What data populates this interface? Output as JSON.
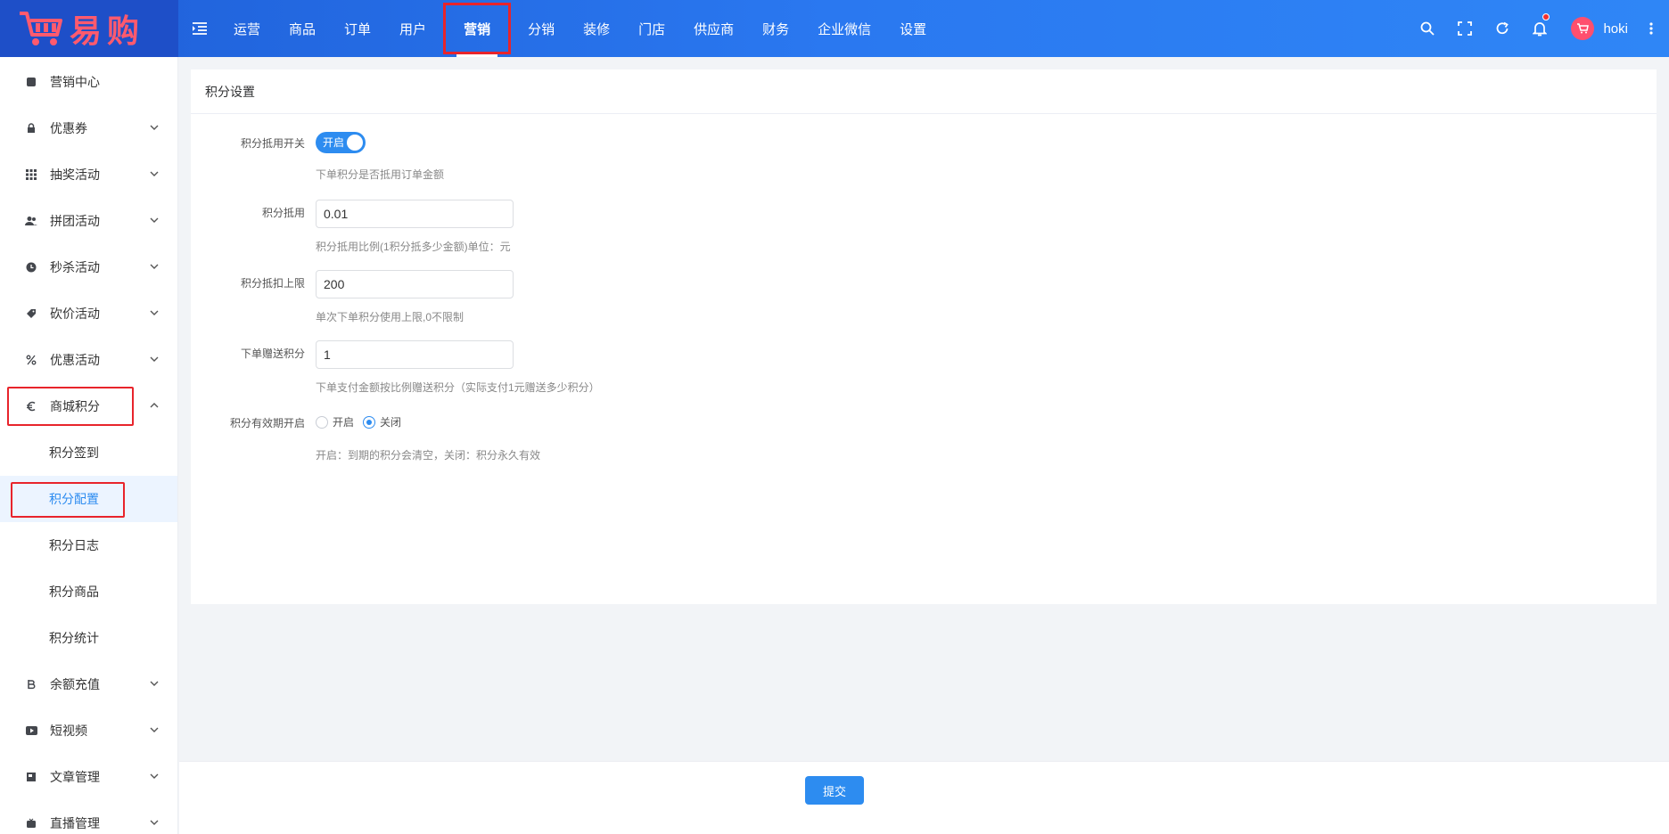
{
  "brand": {
    "name": "易购"
  },
  "nav": {
    "items": [
      {
        "label": "运营"
      },
      {
        "label": "商品"
      },
      {
        "label": "订单"
      },
      {
        "label": "用户"
      },
      {
        "label": "营销"
      },
      {
        "label": "分销"
      },
      {
        "label": "装修"
      },
      {
        "label": "门店"
      },
      {
        "label": "供应商"
      },
      {
        "label": "财务"
      },
      {
        "label": "企业微信"
      },
      {
        "label": "设置"
      }
    ],
    "active": "营销"
  },
  "user": {
    "name": "hoki"
  },
  "sidebar": {
    "items": [
      {
        "label": "营销中心",
        "icon": "square-icon"
      },
      {
        "label": "优惠券",
        "icon": "lock-icon"
      },
      {
        "label": "抽奖活动",
        "icon": "grid-icon"
      },
      {
        "label": "拼团活动",
        "icon": "group-icon"
      },
      {
        "label": "秒杀活动",
        "icon": "clock-icon"
      },
      {
        "label": "砍价活动",
        "icon": "tag-icon"
      },
      {
        "label": "优惠活动",
        "icon": "discount-icon"
      },
      {
        "label": "商城积分",
        "icon": "euro-icon"
      }
    ],
    "sub_items": [
      {
        "label": "积分签到"
      },
      {
        "label": "积分配置"
      },
      {
        "label": "积分日志"
      },
      {
        "label": "积分商品"
      },
      {
        "label": "积分统计"
      }
    ],
    "items_after": [
      {
        "label": "余额充值",
        "icon": "baht-icon"
      },
      {
        "label": "短视频",
        "icon": "video-icon"
      },
      {
        "label": "文章管理",
        "icon": "article-icon"
      },
      {
        "label": "直播管理",
        "icon": "live-icon"
      }
    ]
  },
  "card": {
    "title": "积分设置",
    "fields": {
      "deduct_switch": {
        "label": "积分抵用开关",
        "value": "开启",
        "hint": "下单积分是否抵用订单金额"
      },
      "deduct_rate": {
        "label": "积分抵用",
        "value": "0.01",
        "hint": "积分抵用比例(1积分抵多少金额)单位：元"
      },
      "deduct_limit": {
        "label": "积分抵扣上限",
        "value": "200",
        "hint": "单次下单积分使用上限,0不限制"
      },
      "order_gift": {
        "label": "下单赠送积分",
        "value": "1",
        "hint": "下单支付金额按比例赠送积分（实际支付1元赠送多少积分）"
      },
      "expiry": {
        "label": "积分有效期开启",
        "options": [
          "开启",
          "关闭"
        ],
        "selected": "关闭",
        "hint": "开启：到期的积分会清空，关闭：积分永久有效"
      }
    }
  },
  "footer": {
    "submit_label": "提交"
  },
  "colors": {
    "header": "#2a78f0",
    "accent": "#2d8cf0",
    "highlight_box": "#e8242b",
    "logo_text": "#ff5a6e"
  }
}
